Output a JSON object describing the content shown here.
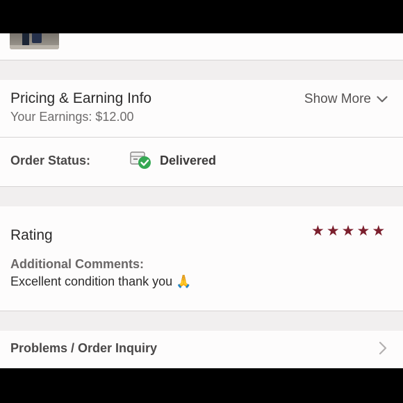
{
  "pricing": {
    "title": "Pricing & Earning Info",
    "earnings": "Your Earnings: $12.00",
    "show_more": "Show More"
  },
  "order_status": {
    "label": "Order Status:",
    "value": "Delivered",
    "icon": "package-delivered-icon"
  },
  "rating": {
    "title": "Rating",
    "stars": 5,
    "star_color": "#7b1f2d",
    "comments_label": "Additional Comments:",
    "comment": "Excellent condition thank you 🙏"
  },
  "problems": {
    "label": "Problems / Order Inquiry"
  }
}
